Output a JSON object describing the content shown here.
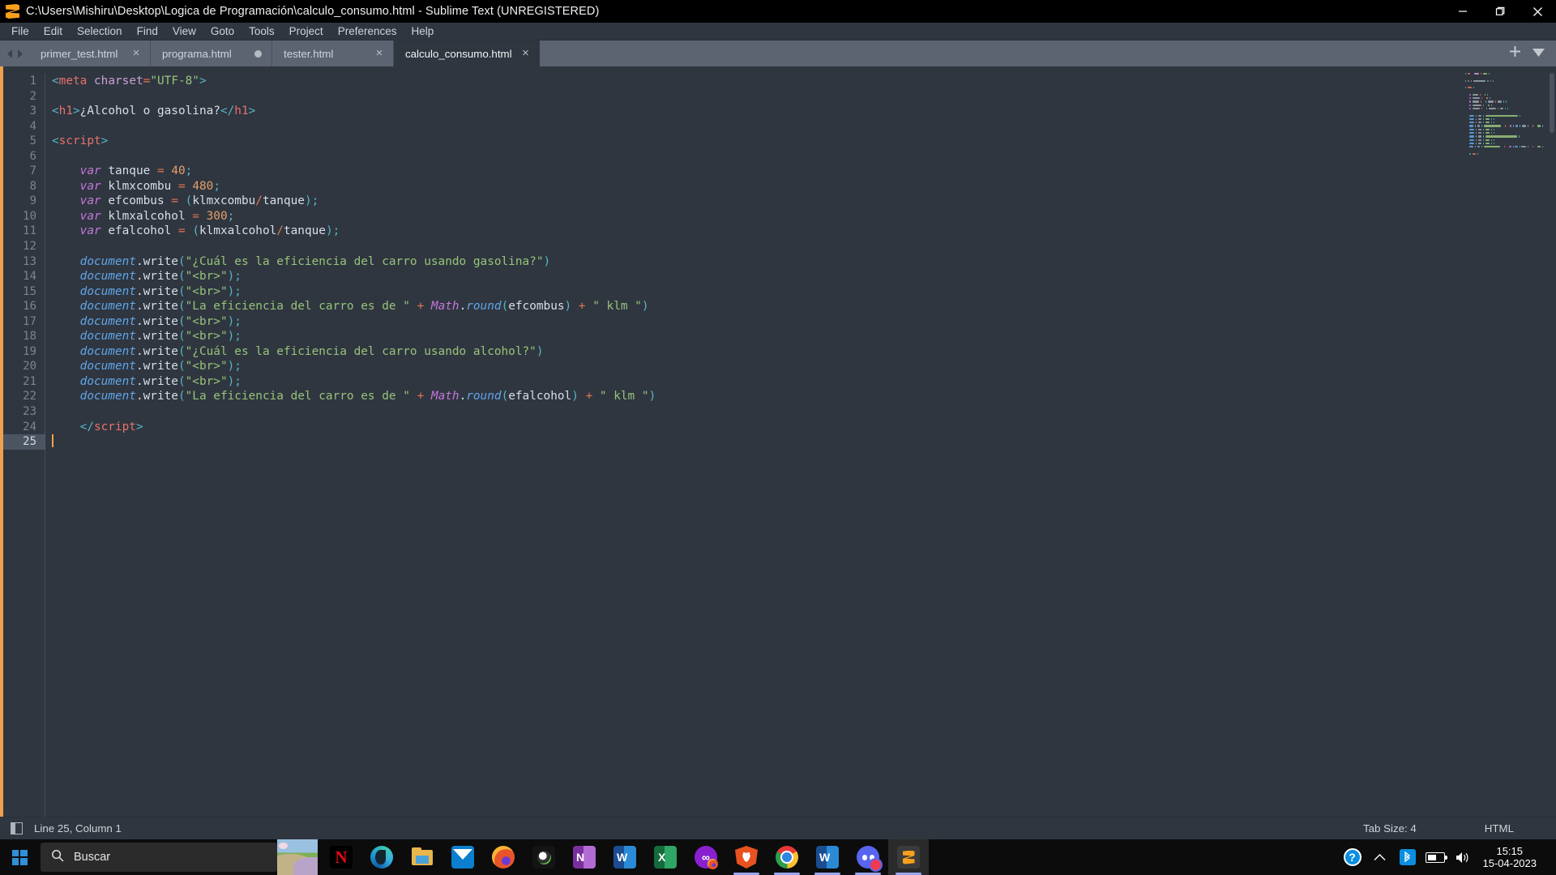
{
  "window": {
    "title": "C:\\Users\\Mishiru\\Desktop\\Logica de Programación\\calculo_consumo.html - Sublime Text (UNREGISTERED)",
    "app_icon": "sublime-text-logo",
    "controls": {
      "minimize": "minimize-icon",
      "maximize": "maximize-icon",
      "close": "close-icon"
    }
  },
  "menubar": {
    "items": [
      "File",
      "Edit",
      "Selection",
      "Find",
      "View",
      "Goto",
      "Tools",
      "Project",
      "Preferences",
      "Help"
    ]
  },
  "tabs": {
    "items": [
      {
        "label": "primer_test.html",
        "active": false,
        "dirty": false
      },
      {
        "label": "programa.html",
        "active": false,
        "dirty": true
      },
      {
        "label": "tester.html",
        "active": false,
        "dirty": false
      },
      {
        "label": "calculo_consumo.html",
        "active": true,
        "dirty": false
      }
    ],
    "new_tab_label": "+",
    "tab_menu_label": "▾"
  },
  "editor": {
    "total_lines": 25,
    "active_line": 25,
    "lines": [
      {
        "n": 1,
        "tokens": [
          {
            "t": "<",
            "c": "t-punct"
          },
          {
            "t": "meta",
            "c": "t-tag"
          },
          {
            "t": " ",
            "c": "t-plain"
          },
          {
            "t": "charset",
            "c": "t-attr"
          },
          {
            "t": "=",
            "c": "t-op"
          },
          {
            "t": "\"UTF-8\"",
            "c": "t-str"
          },
          {
            "t": ">",
            "c": "t-punct"
          }
        ]
      },
      {
        "n": 2,
        "tokens": []
      },
      {
        "n": 3,
        "tokens": [
          {
            "t": "<",
            "c": "t-punct"
          },
          {
            "t": "h1",
            "c": "t-tag"
          },
          {
            "t": ">",
            "c": "t-punct"
          },
          {
            "t": "¿Alcohol o gasolina?",
            "c": "t-plain"
          },
          {
            "t": "</",
            "c": "t-punct"
          },
          {
            "t": "h1",
            "c": "t-tag"
          },
          {
            "t": ">",
            "c": "t-punct"
          }
        ]
      },
      {
        "n": 4,
        "tokens": []
      },
      {
        "n": 5,
        "tokens": [
          {
            "t": "<",
            "c": "t-punct"
          },
          {
            "t": "script",
            "c": "t-tag"
          },
          {
            "t": ">",
            "c": "t-punct"
          }
        ]
      },
      {
        "n": 6,
        "tokens": []
      },
      {
        "n": 7,
        "tokens": [
          {
            "t": "    ",
            "c": "t-plain"
          },
          {
            "t": "var",
            "c": "t-kw"
          },
          {
            "t": " tanque ",
            "c": "t-var"
          },
          {
            "t": "=",
            "c": "t-op"
          },
          {
            "t": " ",
            "c": "t-plain"
          },
          {
            "t": "40",
            "c": "t-num"
          },
          {
            "t": ";",
            "c": "t-punct"
          }
        ]
      },
      {
        "n": 8,
        "tokens": [
          {
            "t": "    ",
            "c": "t-plain"
          },
          {
            "t": "var",
            "c": "t-kw"
          },
          {
            "t": " klmxcombu ",
            "c": "t-var"
          },
          {
            "t": "=",
            "c": "t-op"
          },
          {
            "t": " ",
            "c": "t-plain"
          },
          {
            "t": "480",
            "c": "t-num"
          },
          {
            "t": ";",
            "c": "t-punct"
          }
        ]
      },
      {
        "n": 9,
        "tokens": [
          {
            "t": "    ",
            "c": "t-plain"
          },
          {
            "t": "var",
            "c": "t-kw"
          },
          {
            "t": " efcombus ",
            "c": "t-var"
          },
          {
            "t": "=",
            "c": "t-op"
          },
          {
            "t": " ",
            "c": "t-plain"
          },
          {
            "t": "(",
            "c": "t-punct"
          },
          {
            "t": "klmxcombu",
            "c": "t-var"
          },
          {
            "t": "/",
            "c": "t-op"
          },
          {
            "t": "tanque",
            "c": "t-var"
          },
          {
            "t": ")",
            "c": "t-punct"
          },
          {
            "t": ";",
            "c": "t-punct"
          }
        ]
      },
      {
        "n": 10,
        "tokens": [
          {
            "t": "    ",
            "c": "t-plain"
          },
          {
            "t": "var",
            "c": "t-kw"
          },
          {
            "t": " klmxalcohol ",
            "c": "t-var"
          },
          {
            "t": "=",
            "c": "t-op"
          },
          {
            "t": " ",
            "c": "t-plain"
          },
          {
            "t": "300",
            "c": "t-num"
          },
          {
            "t": ";",
            "c": "t-punct"
          }
        ]
      },
      {
        "n": 11,
        "tokens": [
          {
            "t": "    ",
            "c": "t-plain"
          },
          {
            "t": "var",
            "c": "t-kw"
          },
          {
            "t": " efalcohol ",
            "c": "t-var"
          },
          {
            "t": "=",
            "c": "t-op"
          },
          {
            "t": " ",
            "c": "t-plain"
          },
          {
            "t": "(",
            "c": "t-punct"
          },
          {
            "t": "klmxalcohol",
            "c": "t-var"
          },
          {
            "t": "/",
            "c": "t-op"
          },
          {
            "t": "tanque",
            "c": "t-var"
          },
          {
            "t": ")",
            "c": "t-punct"
          },
          {
            "t": ";",
            "c": "t-punct"
          }
        ]
      },
      {
        "n": 12,
        "tokens": []
      },
      {
        "n": 13,
        "tokens": [
          {
            "t": "    ",
            "c": "t-plain"
          },
          {
            "t": "document",
            "c": "t-obj"
          },
          {
            "t": ".",
            "c": "t-prop"
          },
          {
            "t": "write",
            "c": "t-prop"
          },
          {
            "t": "(",
            "c": "t-punct"
          },
          {
            "t": "\"¿Cuál es la eficiencia del carro usando gasolina?\"",
            "c": "t-str"
          },
          {
            "t": ")",
            "c": "t-punct"
          }
        ]
      },
      {
        "n": 14,
        "tokens": [
          {
            "t": "    ",
            "c": "t-plain"
          },
          {
            "t": "document",
            "c": "t-obj"
          },
          {
            "t": ".",
            "c": "t-prop"
          },
          {
            "t": "write",
            "c": "t-prop"
          },
          {
            "t": "(",
            "c": "t-punct"
          },
          {
            "t": "\"<br>\"",
            "c": "t-str"
          },
          {
            "t": ")",
            "c": "t-punct"
          },
          {
            "t": ";",
            "c": "t-punct"
          }
        ]
      },
      {
        "n": 15,
        "tokens": [
          {
            "t": "    ",
            "c": "t-plain"
          },
          {
            "t": "document",
            "c": "t-obj"
          },
          {
            "t": ".",
            "c": "t-prop"
          },
          {
            "t": "write",
            "c": "t-prop"
          },
          {
            "t": "(",
            "c": "t-punct"
          },
          {
            "t": "\"<br>\"",
            "c": "t-str"
          },
          {
            "t": ")",
            "c": "t-punct"
          },
          {
            "t": ";",
            "c": "t-punct"
          }
        ]
      },
      {
        "n": 16,
        "tokens": [
          {
            "t": "    ",
            "c": "t-plain"
          },
          {
            "t": "document",
            "c": "t-obj"
          },
          {
            "t": ".",
            "c": "t-prop"
          },
          {
            "t": "write",
            "c": "t-prop"
          },
          {
            "t": "(",
            "c": "t-punct"
          },
          {
            "t": "\"La eficiencia del carro es de \"",
            "c": "t-str"
          },
          {
            "t": " ",
            "c": "t-plain"
          },
          {
            "t": "+",
            "c": "t-op"
          },
          {
            "t": " ",
            "c": "t-plain"
          },
          {
            "t": "Math",
            "c": "t-kw"
          },
          {
            "t": ".",
            "c": "t-prop"
          },
          {
            "t": "round",
            "c": "t-fn"
          },
          {
            "t": "(",
            "c": "t-punct"
          },
          {
            "t": "efcombus",
            "c": "t-var"
          },
          {
            "t": ")",
            "c": "t-punct"
          },
          {
            "t": " ",
            "c": "t-plain"
          },
          {
            "t": "+",
            "c": "t-op"
          },
          {
            "t": " ",
            "c": "t-plain"
          },
          {
            "t": "\" klm \"",
            "c": "t-str"
          },
          {
            "t": ")",
            "c": "t-punct"
          }
        ]
      },
      {
        "n": 17,
        "tokens": [
          {
            "t": "    ",
            "c": "t-plain"
          },
          {
            "t": "document",
            "c": "t-obj"
          },
          {
            "t": ".",
            "c": "t-prop"
          },
          {
            "t": "write",
            "c": "t-prop"
          },
          {
            "t": "(",
            "c": "t-punct"
          },
          {
            "t": "\"<br>\"",
            "c": "t-str"
          },
          {
            "t": ")",
            "c": "t-punct"
          },
          {
            "t": ";",
            "c": "t-punct"
          }
        ]
      },
      {
        "n": 18,
        "tokens": [
          {
            "t": "    ",
            "c": "t-plain"
          },
          {
            "t": "document",
            "c": "t-obj"
          },
          {
            "t": ".",
            "c": "t-prop"
          },
          {
            "t": "write",
            "c": "t-prop"
          },
          {
            "t": "(",
            "c": "t-punct"
          },
          {
            "t": "\"<br>\"",
            "c": "t-str"
          },
          {
            "t": ")",
            "c": "t-punct"
          },
          {
            "t": ";",
            "c": "t-punct"
          }
        ]
      },
      {
        "n": 19,
        "tokens": [
          {
            "t": "    ",
            "c": "t-plain"
          },
          {
            "t": "document",
            "c": "t-obj"
          },
          {
            "t": ".",
            "c": "t-prop"
          },
          {
            "t": "write",
            "c": "t-prop"
          },
          {
            "t": "(",
            "c": "t-punct"
          },
          {
            "t": "\"¿Cuál es la eficiencia del carro usando alcohol?\"",
            "c": "t-str"
          },
          {
            "t": ")",
            "c": "t-punct"
          }
        ]
      },
      {
        "n": 20,
        "tokens": [
          {
            "t": "    ",
            "c": "t-plain"
          },
          {
            "t": "document",
            "c": "t-obj"
          },
          {
            "t": ".",
            "c": "t-prop"
          },
          {
            "t": "write",
            "c": "t-prop"
          },
          {
            "t": "(",
            "c": "t-punct"
          },
          {
            "t": "\"<br>\"",
            "c": "t-str"
          },
          {
            "t": ")",
            "c": "t-punct"
          },
          {
            "t": ";",
            "c": "t-punct"
          }
        ]
      },
      {
        "n": 21,
        "tokens": [
          {
            "t": "    ",
            "c": "t-plain"
          },
          {
            "t": "document",
            "c": "t-obj"
          },
          {
            "t": ".",
            "c": "t-prop"
          },
          {
            "t": "write",
            "c": "t-prop"
          },
          {
            "t": "(",
            "c": "t-punct"
          },
          {
            "t": "\"<br>\"",
            "c": "t-str"
          },
          {
            "t": ")",
            "c": "t-punct"
          },
          {
            "t": ";",
            "c": "t-punct"
          }
        ]
      },
      {
        "n": 22,
        "tokens": [
          {
            "t": "    ",
            "c": "t-plain"
          },
          {
            "t": "document",
            "c": "t-obj"
          },
          {
            "t": ".",
            "c": "t-prop"
          },
          {
            "t": "write",
            "c": "t-prop"
          },
          {
            "t": "(",
            "c": "t-punct"
          },
          {
            "t": "\"La eficiencia del carro es de \"",
            "c": "t-str"
          },
          {
            "t": " ",
            "c": "t-plain"
          },
          {
            "t": "+",
            "c": "t-op"
          },
          {
            "t": " ",
            "c": "t-plain"
          },
          {
            "t": "Math",
            "c": "t-kw"
          },
          {
            "t": ".",
            "c": "t-prop"
          },
          {
            "t": "round",
            "c": "t-fn"
          },
          {
            "t": "(",
            "c": "t-punct"
          },
          {
            "t": "efalcohol",
            "c": "t-var"
          },
          {
            "t": ")",
            "c": "t-punct"
          },
          {
            "t": " ",
            "c": "t-plain"
          },
          {
            "t": "+",
            "c": "t-op"
          },
          {
            "t": " ",
            "c": "t-plain"
          },
          {
            "t": "\" klm \"",
            "c": "t-str"
          },
          {
            "t": ")",
            "c": "t-punct"
          }
        ]
      },
      {
        "n": 23,
        "tokens": []
      },
      {
        "n": 24,
        "tokens": [
          {
            "t": "    ",
            "c": "t-plain"
          },
          {
            "t": "</",
            "c": "t-punct"
          },
          {
            "t": "script",
            "c": "t-tag"
          },
          {
            "t": ">",
            "c": "t-punct"
          }
        ]
      },
      {
        "n": 25,
        "tokens": []
      }
    ]
  },
  "statusbar": {
    "sidebar_toggle": "sidebar-toggle-icon",
    "cursor_position": "Line 25, Column 1",
    "tab_size": "Tab Size: 4",
    "language": "HTML"
  },
  "taskbar": {
    "start": "windows-start-icon",
    "search_placeholder": "Buscar",
    "search_icon": "search-icon",
    "apps": [
      {
        "name": "netflix",
        "icon": "netflix-icon",
        "active": false,
        "running": false
      },
      {
        "name": "microsoft-edge",
        "icon": "edge-icon",
        "active": false,
        "running": false
      },
      {
        "name": "file-explorer",
        "icon": "folder-icon",
        "active": false,
        "running": false
      },
      {
        "name": "mail",
        "icon": "mail-icon",
        "active": false,
        "running": false
      },
      {
        "name": "firefox",
        "icon": "firefox-icon",
        "active": false,
        "running": false
      },
      {
        "name": "camera",
        "icon": "camera-icon",
        "active": false,
        "running": false
      },
      {
        "name": "onenote",
        "icon": "onenote-icon",
        "active": false,
        "running": false
      },
      {
        "name": "word",
        "icon": "word-icon",
        "active": false,
        "running": false
      },
      {
        "name": "excel",
        "icon": "excel-icon",
        "active": false,
        "running": false
      },
      {
        "name": "opera-gx",
        "icon": "opera-icon",
        "active": false,
        "running": false
      },
      {
        "name": "brave",
        "icon": "brave-icon",
        "active": false,
        "running": true
      },
      {
        "name": "chrome",
        "icon": "chrome-icon",
        "active": false,
        "running": true
      },
      {
        "name": "word-doc",
        "icon": "word-icon",
        "active": false,
        "running": true
      },
      {
        "name": "discord",
        "icon": "discord-icon",
        "active": false,
        "running": true
      },
      {
        "name": "sublime-text",
        "icon": "sublime-icon",
        "active": true,
        "running": true
      }
    ],
    "tray": {
      "help": "?",
      "chevron": "show-hidden-icons",
      "bluetooth": "bluetooth-icon",
      "battery": "battery-icon",
      "volume": "volume-icon",
      "time": "15:15",
      "date": "15-04-2023"
    }
  }
}
